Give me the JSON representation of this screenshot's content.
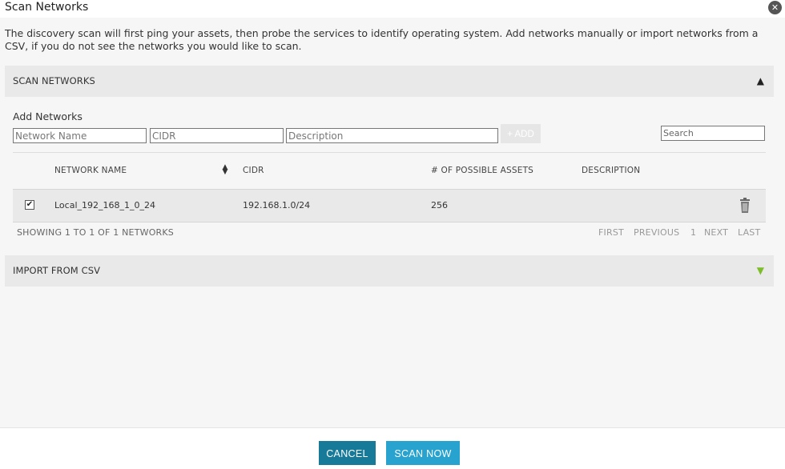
{
  "window": {
    "title": "Scan Networks",
    "close_glyph": "✕"
  },
  "intro": "The discovery scan will first ping your assets, then probe the services to identify operating system. Add networks manually or import networks from a CSV, if you do not see the networks you would like to scan.",
  "scan_panel": {
    "title": "SCAN NETWORKS",
    "toggle_glyph": "▲",
    "add_label": "Add Networks",
    "inputs": {
      "name_placeholder": "Network Name",
      "cidr_placeholder": "CIDR",
      "description_placeholder": "Description",
      "add_label": "+ ADD",
      "search_placeholder": "Search"
    },
    "columns": [
      "NETWORK NAME",
      "CIDR",
      "# OF POSSIBLE ASSETS",
      "DESCRIPTION"
    ],
    "sort_glyph": "▲▼",
    "rows": [
      {
        "checked_glyph": "✔",
        "name": "Local_192_168_1_0_24",
        "cidr": "192.168.1.0/24",
        "assets": "256",
        "description": ""
      }
    ],
    "footer": "SHOWING 1 TO 1 OF 1 NETWORKS",
    "pager": {
      "first": "FIRST",
      "previous": "PREVIOUS",
      "page": "1",
      "next": "NEXT",
      "last": "LAST"
    }
  },
  "csv_panel": {
    "title": "IMPORT FROM CSV",
    "toggle_glyph": "▼"
  },
  "buttons": {
    "cancel": "CANCEL",
    "scan_now": "SCAN NOW"
  },
  "colors": {
    "cancel_bg": "#187a99",
    "scan_bg": "#28a3cf",
    "expand_green": "#7cbd2a"
  },
  "icons": {
    "close": "close-icon",
    "trash": "trash-icon",
    "sort": "sort-icon",
    "collapse": "caret-up-icon",
    "expand": "caret-down-icon"
  }
}
